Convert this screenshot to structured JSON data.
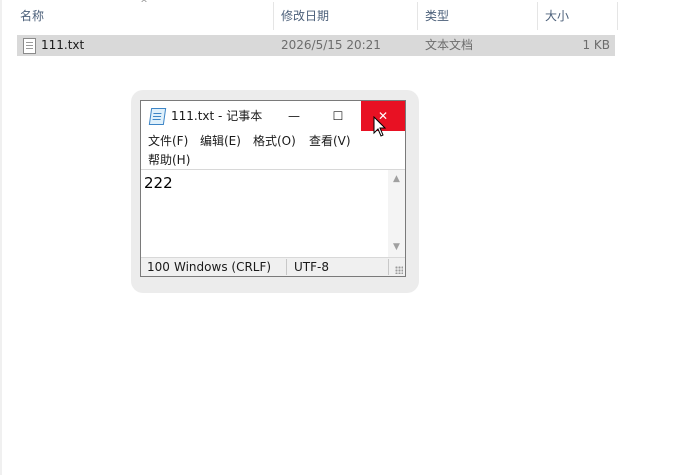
{
  "explorer": {
    "columns": {
      "name": "名称",
      "modified": "修改日期",
      "type": "类型",
      "size": "大小"
    },
    "files": [
      {
        "name": "111.txt",
        "modified": "2026/5/15 20:21",
        "type": "文本文档",
        "size": "1 KB",
        "selected": true
      }
    ]
  },
  "notepad": {
    "title": "111.txt - 记事本",
    "title_buttons": {
      "minimize": "—",
      "maximize": "☐",
      "close": "✕"
    },
    "menu": [
      "文件(F)",
      "编辑(E)",
      "格式(O)",
      "查看(V)",
      "帮助(H)"
    ],
    "content": "222",
    "status": {
      "zoom": "100",
      "line_ending": "Windows (CRLF)",
      "encoding": "UTF-8"
    },
    "close_color": "#e81123"
  }
}
